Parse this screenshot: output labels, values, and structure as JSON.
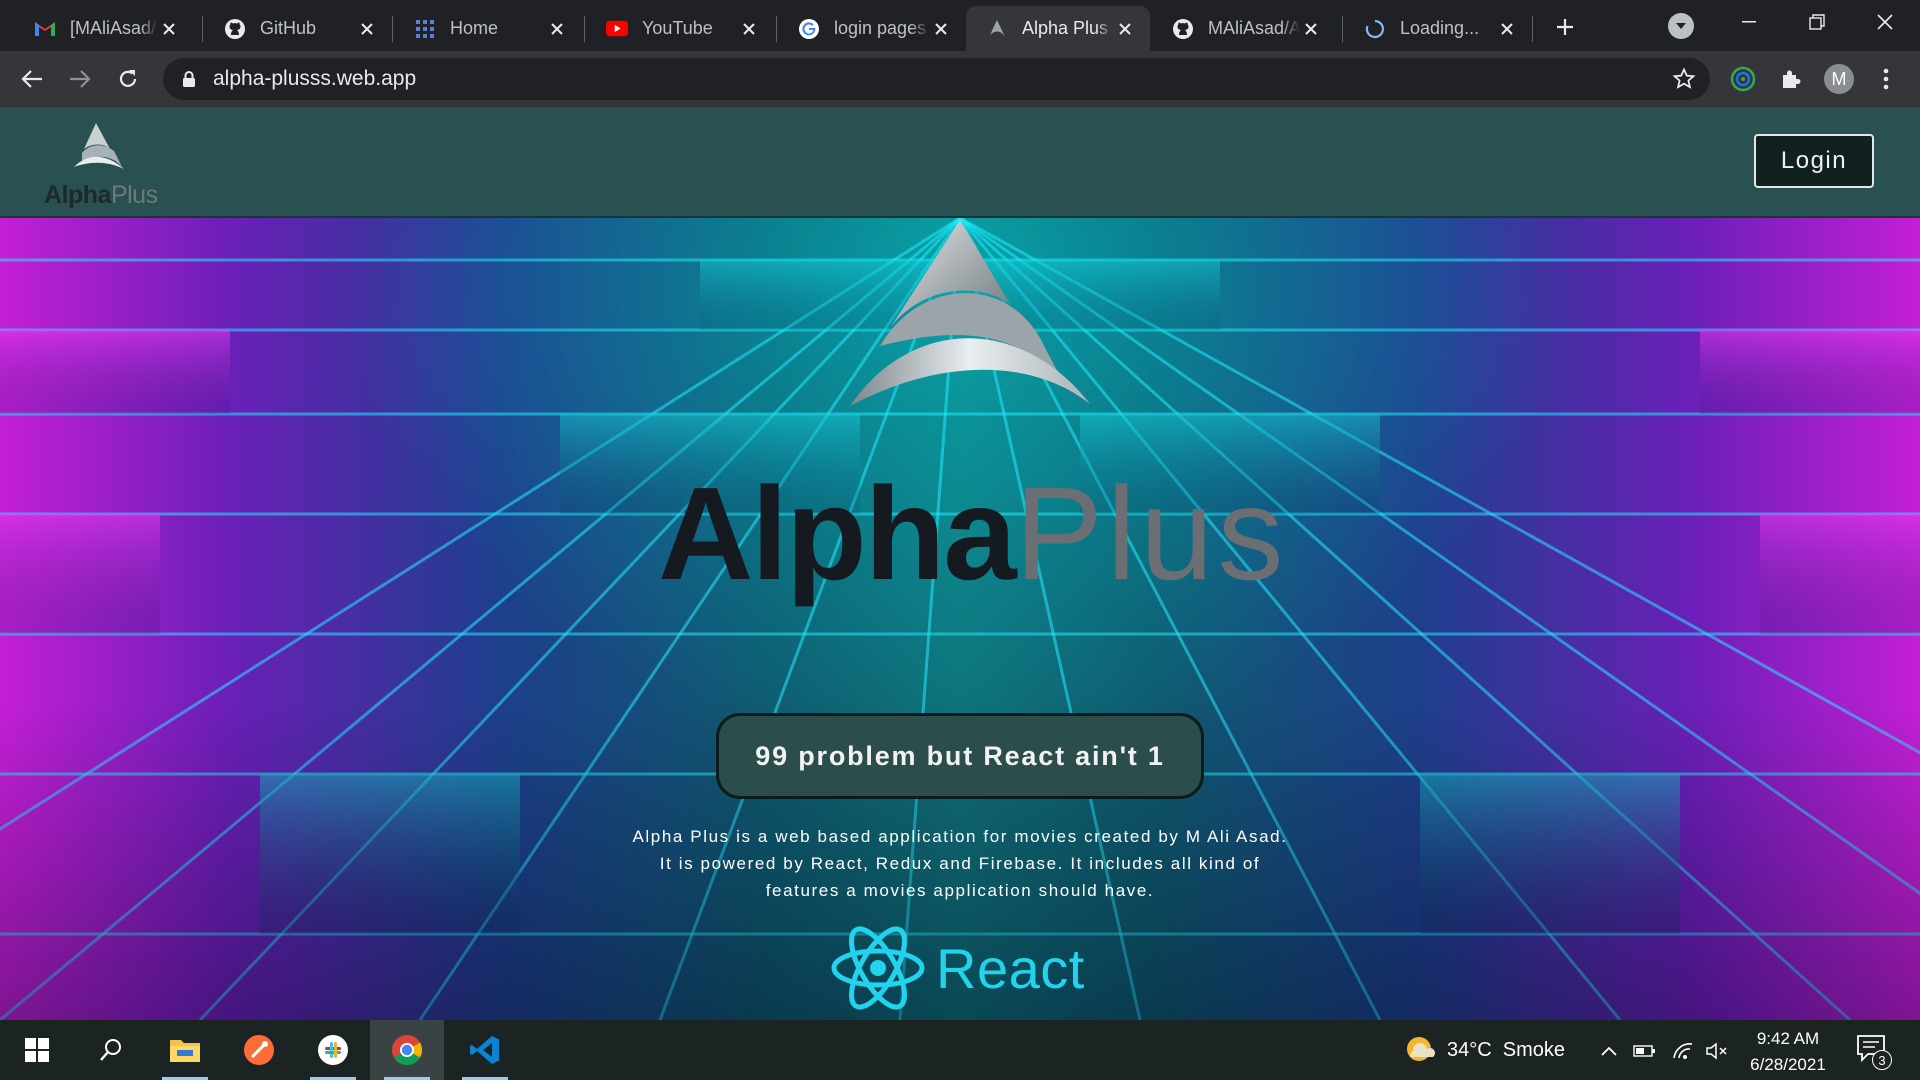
{
  "browser": {
    "tabs": [
      {
        "title": "[MAliAsad/S",
        "icon": "gmail-icon"
      },
      {
        "title": "GitHub",
        "icon": "github-icon"
      },
      {
        "title": "Home",
        "icon": "grid-icon"
      },
      {
        "title": "YouTube",
        "icon": "youtube-icon"
      },
      {
        "title": "login pages",
        "icon": "google-icon"
      },
      {
        "title": "Alpha Plus",
        "icon": "alpha-icon",
        "active": true
      },
      {
        "title": "MAliAsad/A",
        "icon": "github-icon"
      },
      {
        "title": "Loading...",
        "icon": "spinner-icon"
      }
    ],
    "url": "alpha-plusss.web.app",
    "profile_initial": "M"
  },
  "header": {
    "brand_word_1": "Alpha",
    "brand_word_2": "Plus",
    "login_label": "Login"
  },
  "hero": {
    "logo_word_1": "Alpha",
    "logo_word_2": "Plus",
    "tagline": "99 problem but React ain't 1",
    "description_lines": [
      "Alpha Plus is a web based application for movies created by M Ali Asad.",
      "It is powered by React, Redux and Firebase. It includes all kind of",
      "features a movies application should have."
    ],
    "react_label": "React"
  },
  "taskbar": {
    "weather": "34°C  Smoke",
    "time": "9:42 AM",
    "date": "6/28/2021",
    "notifications": "3"
  },
  "colors": {
    "header_bg": "#2a5152",
    "react_cyan": "#22d3ee",
    "tab_strip": "#202124",
    "toolbar": "#35363a"
  }
}
